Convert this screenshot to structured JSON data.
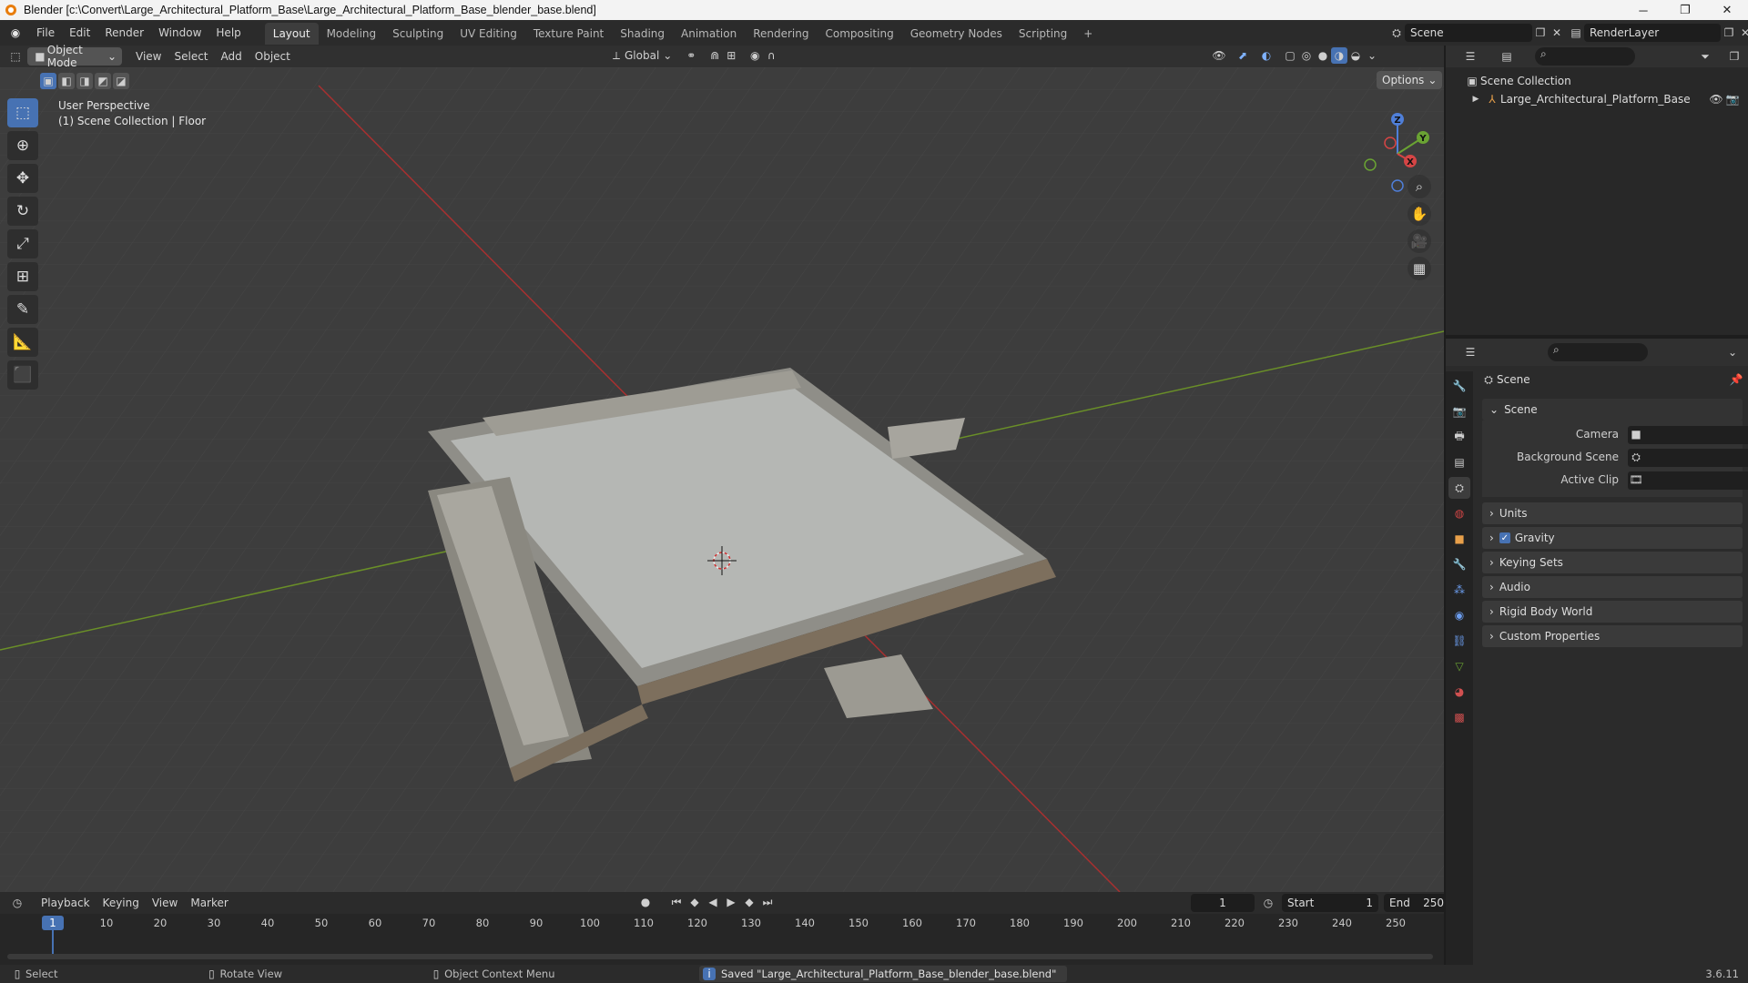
{
  "window": {
    "title": "Blender [c:\\Convert\\Large_Architectural_Platform_Base\\Large_Architectural_Platform_Base_blender_base.blend]",
    "minimize": "─",
    "maximize": "❐",
    "close": "✕"
  },
  "menu": [
    "File",
    "Edit",
    "Render",
    "Window",
    "Help"
  ],
  "workspaces": [
    "Layout",
    "Modeling",
    "Sculpting",
    "UV Editing",
    "Texture Paint",
    "Shading",
    "Animation",
    "Rendering",
    "Compositing",
    "Geometry Nodes",
    "Scripting"
  ],
  "active_workspace": "Layout",
  "add_workspace": "+",
  "scene_name": "Scene",
  "render_layer": "RenderLayer",
  "viewport_header": {
    "mode": "Object Mode",
    "menus": [
      "View",
      "Select",
      "Add",
      "Object"
    ],
    "transform": "Global",
    "options": "Options"
  },
  "viewport": {
    "perspective": "User Perspective",
    "collection": "(1) Scene Collection | Floor",
    "gizmo_axes": [
      "Z",
      "Y",
      "X"
    ]
  },
  "tools": [
    "select-box-icon",
    "cursor-icon",
    "move-icon",
    "rotate-icon",
    "scale-icon",
    "transform-icon",
    "annotate-icon",
    "measure-icon",
    "add-cube-icon"
  ],
  "outliner": {
    "root": "Scene Collection",
    "items": [
      {
        "name": "Large_Architectural_Platform_Base"
      }
    ]
  },
  "properties": {
    "header": "Scene",
    "section": "Scene",
    "fields": [
      {
        "label": "Camera"
      },
      {
        "label": "Background Scene"
      },
      {
        "label": "Active Clip"
      }
    ],
    "panels": [
      "Units",
      "Gravity",
      "Keying Sets",
      "Audio",
      "Rigid Body World",
      "Custom Properties"
    ],
    "gravity_checked": true,
    "checkmark": "✓"
  },
  "timeline": {
    "menus": [
      "Playback",
      "Keying",
      "View",
      "Marker"
    ],
    "current_frame": "1",
    "start_label": "Start",
    "start": "1",
    "end_label": "End",
    "end": "250",
    "ruler": [
      "10",
      "20",
      "30",
      "40",
      "50",
      "60",
      "70",
      "80",
      "90",
      "100",
      "110",
      "120",
      "130",
      "140",
      "150",
      "160",
      "170",
      "180",
      "190",
      "200",
      "210",
      "220",
      "230",
      "240",
      "250"
    ],
    "playhead": "1"
  },
  "status": {
    "select": "Select",
    "rotate": "Rotate View",
    "context": "Object Context Menu",
    "message": "Saved \"Large_Architectural_Platform_Base_blender_base.blend\"",
    "version": "3.6.11"
  }
}
